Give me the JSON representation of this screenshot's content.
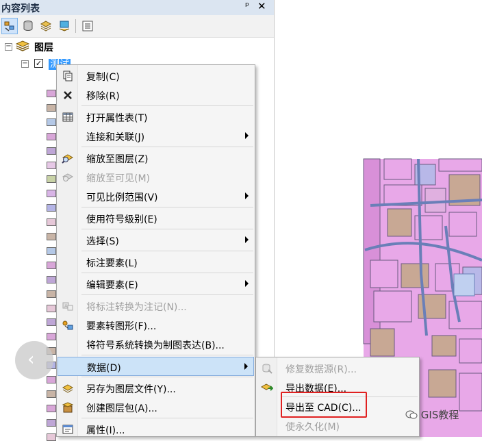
{
  "panel": {
    "title": "内容列表",
    "pin_glyph": "ᵖ",
    "close_glyph": "✕"
  },
  "tree": {
    "root_label": "图层",
    "layer_label": "测试",
    "checkbox_glyph": "✓",
    "legend_colors": [
      "#d8a6d8",
      "#c8b4a6",
      "#b4c8e6",
      "#d8a6d8",
      "#bea6d6",
      "#e6c8e6",
      "#c8d2a6",
      "#d8b4e6",
      "#b4b4e6",
      "#e6c8d8",
      "#c8b4a6",
      "#b4c8e6",
      "#d8a6d8",
      "#bea6d6",
      "#c8b4a6",
      "#e6c8d8",
      "#bea6d6",
      "#d8a6d8",
      "#c8b4a6",
      "#b4b4e6",
      "#d8a6d8",
      "#c8b4a6",
      "#d8a6d8",
      "#bea6d6",
      "#e6c8d8"
    ]
  },
  "context_menu": {
    "items": [
      {
        "label": "复制(C)",
        "icon": "copy-icon",
        "enabled": true
      },
      {
        "label": "移除(R)",
        "icon": "remove-icon",
        "enabled": true
      },
      {
        "label": "打开属性表(T)",
        "icon": "table-icon",
        "enabled": true
      },
      {
        "label": "连接和关联(J)",
        "icon": "",
        "enabled": true,
        "submenu": true
      },
      {
        "label": "缩放至图层(Z)",
        "icon": "zoom-to-layer-icon",
        "enabled": true
      },
      {
        "label": "缩放至可见(M)",
        "icon": "zoom-to-visible-icon",
        "enabled": false
      },
      {
        "label": "可见比例范围(V)",
        "icon": "",
        "enabled": true,
        "submenu": true
      },
      {
        "label": "使用符号级别(E)",
        "icon": "",
        "enabled": true
      },
      {
        "label": "选择(S)",
        "icon": "",
        "enabled": true,
        "submenu": true
      },
      {
        "label": "标注要素(L)",
        "icon": "",
        "enabled": true
      },
      {
        "label": "编辑要素(E)",
        "icon": "",
        "enabled": true,
        "submenu": true
      },
      {
        "label": "将标注转换为注记(N)...",
        "icon": "convert-labels-icon",
        "enabled": false
      },
      {
        "label": "要素转图形(F)...",
        "icon": "features-to-graphics-icon",
        "enabled": true
      },
      {
        "label": "将符号系统转换为制图表达(B)...",
        "icon": "",
        "enabled": true
      },
      {
        "label": "数据(D)",
        "icon": "",
        "enabled": true,
        "submenu": true,
        "selected": true
      },
      {
        "label": "另存为图层文件(Y)...",
        "icon": "save-layer-icon",
        "enabled": true
      },
      {
        "label": "创建图层包(A)...",
        "icon": "layer-package-icon",
        "enabled": true
      },
      {
        "label": "属性(I)...",
        "icon": "properties-icon",
        "enabled": true
      }
    ]
  },
  "data_submenu": {
    "items": [
      {
        "label": "修复数据源(R)...",
        "icon": "repair-data-source-icon",
        "enabled": false
      },
      {
        "label": "导出数据(E)...",
        "icon": "export-data-icon",
        "enabled": true
      },
      {
        "label": "导出至 CAD(C)...",
        "icon": "",
        "enabled": true
      },
      {
        "label": "使永久化(M)",
        "icon": "",
        "enabled": false
      }
    ]
  },
  "nav": {
    "glyph": "‹"
  },
  "watermark": {
    "text": "GIS教程"
  },
  "colors": {
    "selection": "#3399ff",
    "menu_highlight": "#cce3f8",
    "callout_red": "#e02020",
    "map_parcel_pink": "#e8a8e8",
    "map_parcel_brown": "#c8a894",
    "map_road": "#6a7fb8"
  }
}
